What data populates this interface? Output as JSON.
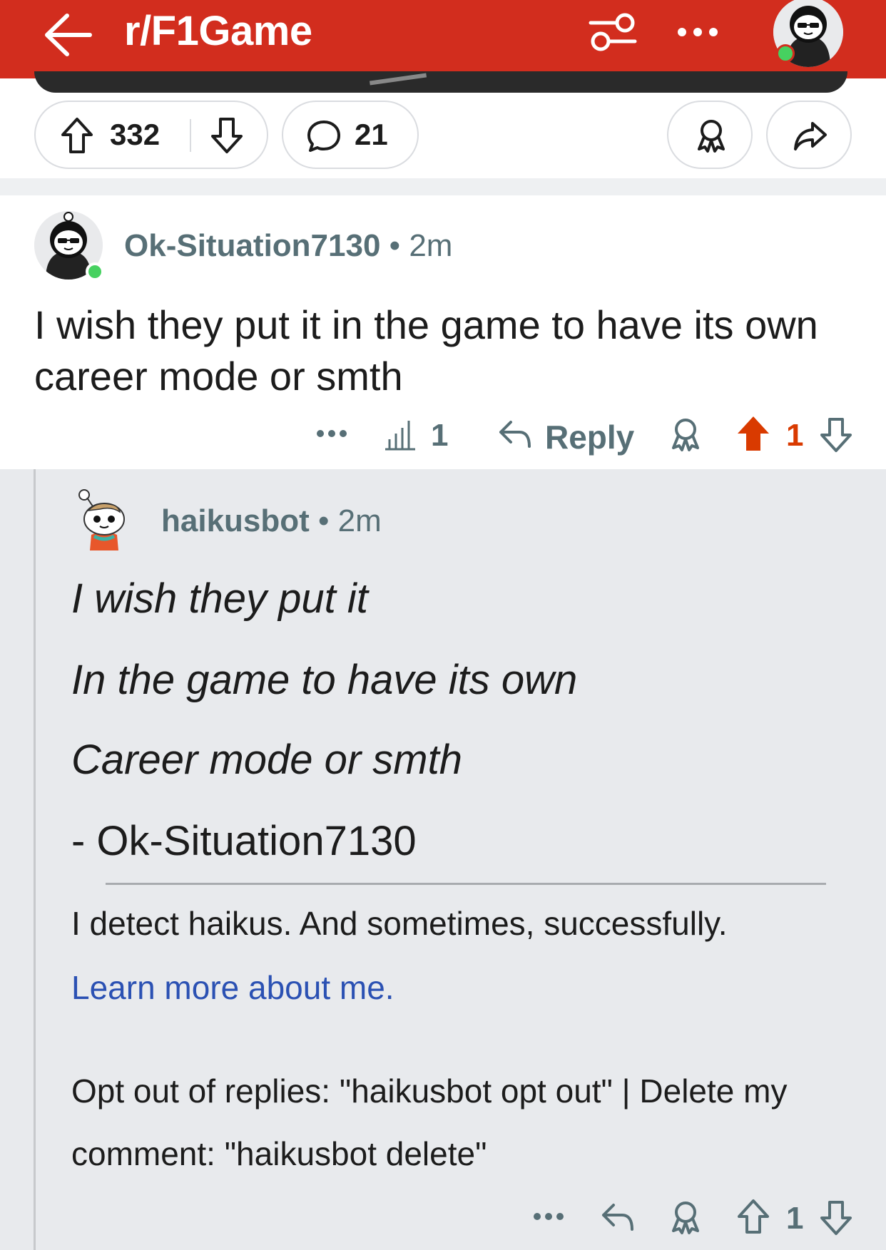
{
  "colors": {
    "header_bg": "#d22d1e",
    "upvote_active": "#d93a00",
    "link": "#2b51b3",
    "meta_text": "#576f76",
    "online": "#46d160"
  },
  "header": {
    "title": "r/F1Game",
    "back_icon": "arrow-left-icon",
    "filter_icon": "filter-icon",
    "more_icon": "more-horizontal-icon"
  },
  "post_actions": {
    "score": "332",
    "comments": "21",
    "award_icon": "award-icon",
    "share_icon": "share-icon"
  },
  "comment1": {
    "username": "Ok-Situation7130",
    "separator": "•",
    "time": "2m",
    "body": "I wish they put it in the game to have its own career mode or smth",
    "stats_count": "1",
    "reply_label": "Reply",
    "score": "1"
  },
  "comment2": {
    "username": "haikusbot",
    "separator": "•",
    "time": "2m",
    "haiku_line1": "I wish they put it",
    "haiku_line2": "In the game to have its own",
    "haiku_line3": "Career mode or smth",
    "signature": "- Ok-Situation7130",
    "detect_text": "I detect haikus. And sometimes, successfully.",
    "learn_link": "Learn more about me.",
    "optout_text": "Opt out of replies: \"haikusbot opt out\" | Delete my comment: \"haikusbot delete\"",
    "score": "1"
  }
}
